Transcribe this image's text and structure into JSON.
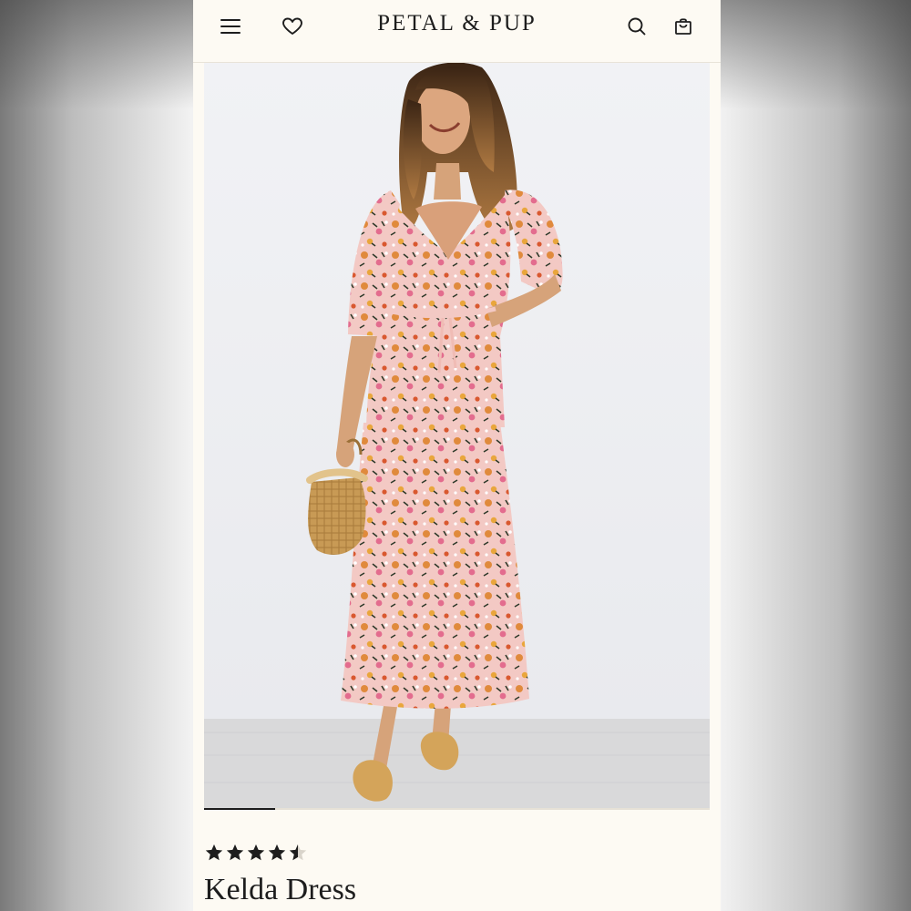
{
  "header": {
    "brand": "PETAL & PUP",
    "icons": [
      "menu-icon",
      "heart-icon",
      "search-icon",
      "cart-icon"
    ]
  },
  "product": {
    "image_alt": "Model wearing a floral midi dress holding a straw basket bag",
    "title": "Kelda Dress",
    "rating": 4.5,
    "rating_max": 5
  },
  "carousel": {
    "current": 1,
    "progress": 0.14
  },
  "colors": {
    "background": "#fdfaf3",
    "text": "#1d1d1d",
    "dress_base": "#f3c9c4",
    "floral_orange": "#e08a3c",
    "floral_pink": "#e36c8e",
    "straw": "#c89a55"
  }
}
